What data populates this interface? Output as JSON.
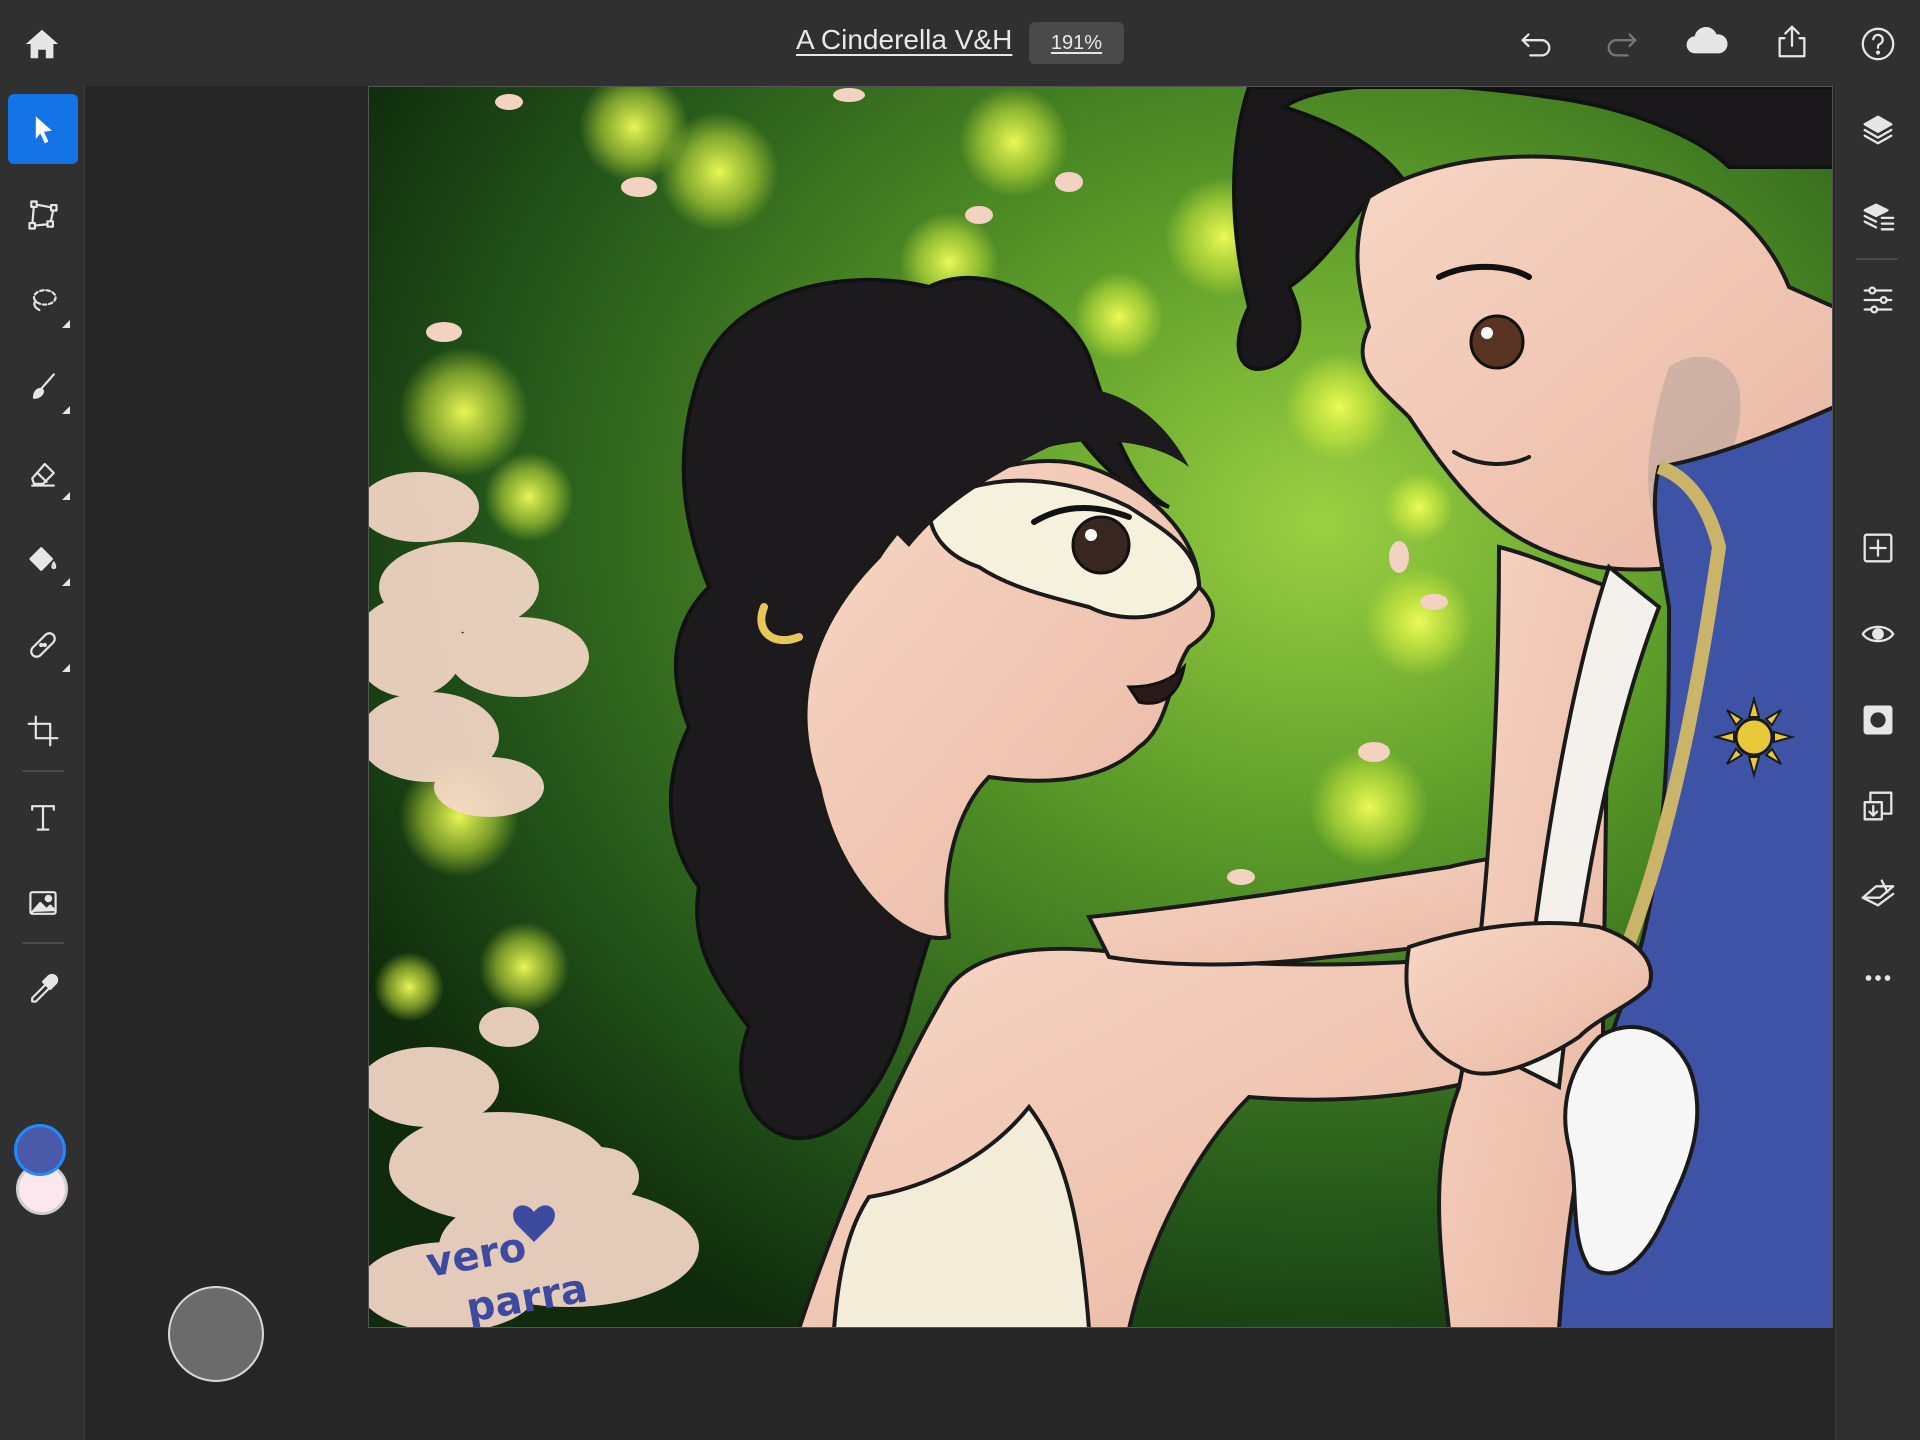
{
  "document": {
    "title": "A Cinderella V&H",
    "zoom": "191%"
  },
  "topbar_icons": [
    "home-icon",
    "undo-icon",
    "redo-icon",
    "cloud-icon",
    "share-icon",
    "help-icon"
  ],
  "tools": [
    "select-tool",
    "transform-tool",
    "lasso-tool",
    "brush-tool",
    "eraser-tool",
    "fill-tool",
    "heal-tool",
    "crop-tool",
    "type-tool",
    "place-image-tool",
    "eyedropper-tool"
  ],
  "right_panel": [
    "layers-icon",
    "layer-properties-icon",
    "adjustments-icon",
    "add-layer-icon",
    "visibility-icon",
    "mask-icon",
    "fill-layer-icon",
    "clear-icon",
    "more-icon"
  ],
  "colors": {
    "foreground": "#4a5aa8",
    "background": "#fde7ef",
    "accent": "#1473e6"
  },
  "artwork": {
    "signature": "vero parra"
  }
}
